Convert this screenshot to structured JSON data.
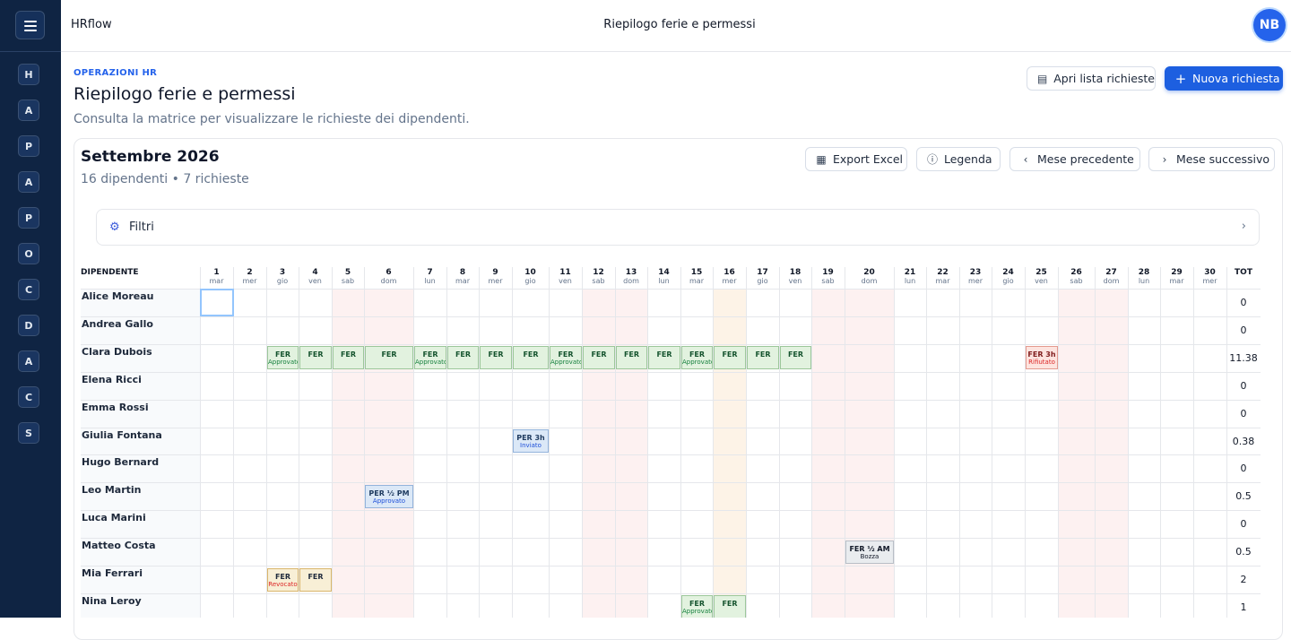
{
  "app": {
    "brand": "HRflow",
    "top_title": "Riepilogo ferie e permessi",
    "avatar_initials": "NB"
  },
  "sidebar": {
    "items": [
      "H",
      "A",
      "P",
      "A",
      "P",
      "O",
      "C",
      "D",
      "A",
      "C",
      "S"
    ]
  },
  "header": {
    "eyebrow": "OPERAZIONI HR",
    "title": "Riepilogo ferie e permessi",
    "subtitle": "Consulta la matrice per visualizzare le richieste dei dipendenti.",
    "open_list_label": "Apri lista richieste",
    "new_request_label": "Nuova richiesta"
  },
  "panel": {
    "month": "Settembre 2026",
    "counts": "16 dipendenti • 7 richieste",
    "export_label": "Export Excel",
    "legend_label": "Legenda",
    "prev_label": "Mese precedente",
    "next_label": "Mese successivo",
    "filters_label": "Filtri"
  },
  "matrix": {
    "employee_header": "DIPENDENTE",
    "total_header": "TOT",
    "days": [
      {
        "n": "1",
        "w": "mar"
      },
      {
        "n": "2",
        "w": "mer"
      },
      {
        "n": "3",
        "w": "gio"
      },
      {
        "n": "4",
        "w": "ven"
      },
      {
        "n": "5",
        "w": "sab",
        "we": true
      },
      {
        "n": "6",
        "w": "dom",
        "we": true
      },
      {
        "n": "7",
        "w": "lun"
      },
      {
        "n": "8",
        "w": "mar"
      },
      {
        "n": "9",
        "w": "mer"
      },
      {
        "n": "10",
        "w": "gio"
      },
      {
        "n": "11",
        "w": "ven"
      },
      {
        "n": "12",
        "w": "sab",
        "we": true
      },
      {
        "n": "13",
        "w": "dom",
        "we": true
      },
      {
        "n": "14",
        "w": "lun"
      },
      {
        "n": "15",
        "w": "mar"
      },
      {
        "n": "16",
        "w": "mer",
        "today": true
      },
      {
        "n": "17",
        "w": "gio"
      },
      {
        "n": "18",
        "w": "ven"
      },
      {
        "n": "19",
        "w": "sab",
        "we": true
      },
      {
        "n": "20",
        "w": "dom",
        "we": true
      },
      {
        "n": "21",
        "w": "lun"
      },
      {
        "n": "22",
        "w": "mar"
      },
      {
        "n": "23",
        "w": "mer"
      },
      {
        "n": "24",
        "w": "gio"
      },
      {
        "n": "25",
        "w": "ven"
      },
      {
        "n": "26",
        "w": "sab",
        "we": true
      },
      {
        "n": "27",
        "w": "dom",
        "we": true
      },
      {
        "n": "28",
        "w": "lun"
      },
      {
        "n": "29",
        "w": "mar"
      },
      {
        "n": "30",
        "w": "mer"
      }
    ],
    "employees": [
      {
        "name": "Alice Moreau",
        "total": "0"
      },
      {
        "name": "Andrea Gallo",
        "total": "0"
      },
      {
        "name": "Clara Dubois",
        "total": "11.38"
      },
      {
        "name": "Elena Ricci",
        "total": "0"
      },
      {
        "name": "Emma Rossi",
        "total": "0"
      },
      {
        "name": "Giulia Fontana",
        "total": "0.38"
      },
      {
        "name": "Hugo Bernard",
        "total": "0"
      },
      {
        "name": "Leo Martin",
        "total": "0.5"
      },
      {
        "name": "Luca Marini",
        "total": "0"
      },
      {
        "name": "Matteo Costa",
        "total": "0.5"
      },
      {
        "name": "Mia Ferrari",
        "total": "2"
      },
      {
        "name": "Nina Leroy",
        "total": "1"
      }
    ],
    "events": [
      {
        "row": 2,
        "day": 3,
        "label": "FER",
        "status": "Approvato",
        "tone": "g"
      },
      {
        "row": 2,
        "day": 4,
        "label": "FER",
        "status": "",
        "tone": "g"
      },
      {
        "row": 2,
        "day": 5,
        "label": "FER",
        "status": "",
        "tone": "g"
      },
      {
        "row": 2,
        "day": 6,
        "label": "FER",
        "status": "",
        "tone": "g"
      },
      {
        "row": 2,
        "day": 7,
        "label": "FER",
        "status": "Approvato",
        "tone": "g"
      },
      {
        "row": 2,
        "day": 8,
        "label": "FER",
        "status": "",
        "tone": "g"
      },
      {
        "row": 2,
        "day": 9,
        "label": "FER",
        "status": "",
        "tone": "g"
      },
      {
        "row": 2,
        "day": 10,
        "label": "FER",
        "status": "",
        "tone": "g"
      },
      {
        "row": 2,
        "day": 11,
        "label": "FER",
        "status": "Approvato",
        "tone": "g"
      },
      {
        "row": 2,
        "day": 12,
        "label": "FER",
        "status": "",
        "tone": "g"
      },
      {
        "row": 2,
        "day": 13,
        "label": "FER",
        "status": "",
        "tone": "g"
      },
      {
        "row": 2,
        "day": 14,
        "label": "FER",
        "status": "",
        "tone": "g"
      },
      {
        "row": 2,
        "day": 15,
        "label": "FER",
        "status": "Approvato",
        "tone": "g"
      },
      {
        "row": 2,
        "day": 16,
        "label": "FER",
        "status": "",
        "tone": "g"
      },
      {
        "row": 2,
        "day": 17,
        "label": "FER",
        "status": "",
        "tone": "g"
      },
      {
        "row": 2,
        "day": 18,
        "label": "FER",
        "status": "",
        "tone": "g"
      },
      {
        "row": 2,
        "day": 25,
        "label": "FER 3h",
        "status": "Rifiutato",
        "tone": "r"
      },
      {
        "row": 5,
        "day": 10,
        "label": "PER 3h",
        "status": "Inviato",
        "tone": "b"
      },
      {
        "row": 7,
        "day": 6,
        "label": "PER ½ PM",
        "status": "Approvato",
        "tone": "b"
      },
      {
        "row": 9,
        "day": 20,
        "label": "FER ½ AM",
        "status": "Bozza",
        "tone": "gr"
      },
      {
        "row": 10,
        "day": 3,
        "label": "FER",
        "status": "Revocato",
        "tone": "y"
      },
      {
        "row": 10,
        "day": 4,
        "label": "FER",
        "status": "",
        "tone": "y"
      },
      {
        "row": 11,
        "day": 15,
        "label": "FER",
        "status": "Approvato",
        "tone": "g"
      },
      {
        "row": 11,
        "day": 16,
        "label": "FER",
        "status": "",
        "tone": "g"
      }
    ]
  }
}
